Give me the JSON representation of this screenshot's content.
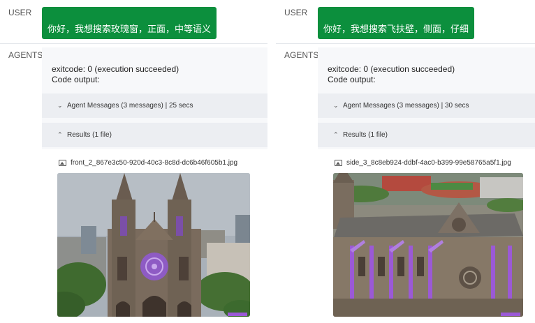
{
  "panels": [
    {
      "user_label": "USER",
      "user_message": "你好，我想搜索玫瑰窗，正面，中等语义",
      "agents_label": "AGENTS",
      "exitcode_text": "exitcode: 0 (execution succeeded)",
      "code_output_label": "Code output:",
      "agent_messages_label": "Agent Messages (3 messages) | 25 secs",
      "results_label": "Results (1 file)",
      "file_name": "front_2_867e3c50-920d-40c3-8c8d-dc6b46f605b1.jpg",
      "image_icon": "image-icon"
    },
    {
      "user_label": "USER",
      "user_message": "你好，我想搜索飞扶壁，侧面，仔细",
      "agents_label": "AGENTS",
      "exitcode_text": "exitcode: 0 (execution succeeded)",
      "code_output_label": "Code output:",
      "agent_messages_label": "Agent Messages (3 messages) | 30 secs",
      "results_label": "Results (1 file)",
      "file_name": "side_3_8c8eb924-ddbf-4ac0-b399-99e58765a5f1.jpg",
      "image_icon": "image-icon"
    }
  ],
  "colors": {
    "user_bubble": "#0c8f3d",
    "section_bg": "#eceef2",
    "highlight": "#9b59d6"
  }
}
